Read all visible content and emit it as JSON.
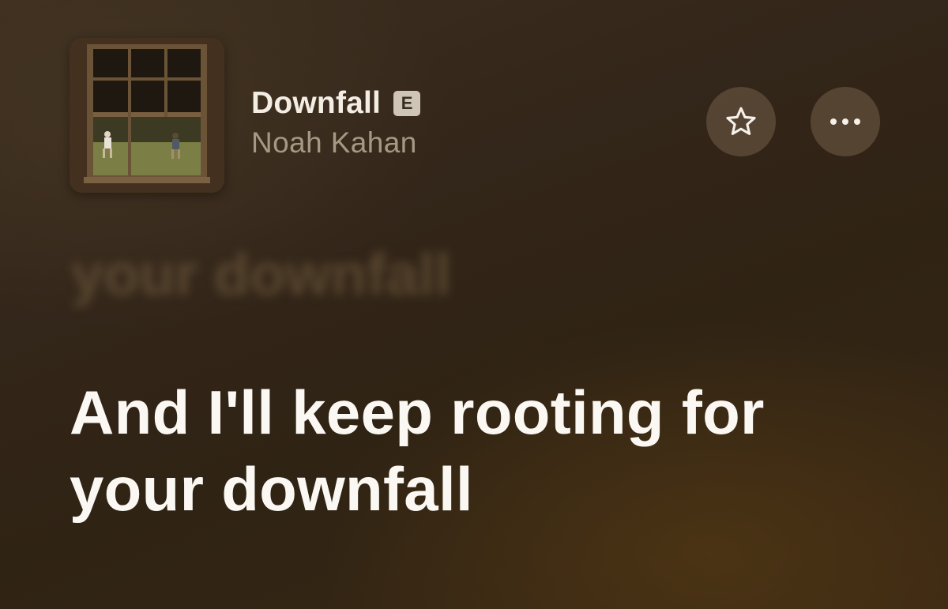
{
  "now_playing": {
    "title": "Downfall",
    "explicit_badge": "E",
    "artist": "Noah Kahan",
    "artwork_icon": "album-artwork"
  },
  "actions": {
    "favorite_icon": "star-outline-icon",
    "more_icon": "ellipsis-icon"
  },
  "lyrics": {
    "previous_line_faint": "",
    "previous_line": "your downfall",
    "current_line_1": "And I'll keep rooting for",
    "current_line_2": "your downfall"
  },
  "colors": {
    "background": "#352818",
    "lyric_active": "#fbf8f3",
    "artist_text": "#a69983",
    "badge": "#cfc5b6",
    "button_bg": "#6e5b45"
  }
}
